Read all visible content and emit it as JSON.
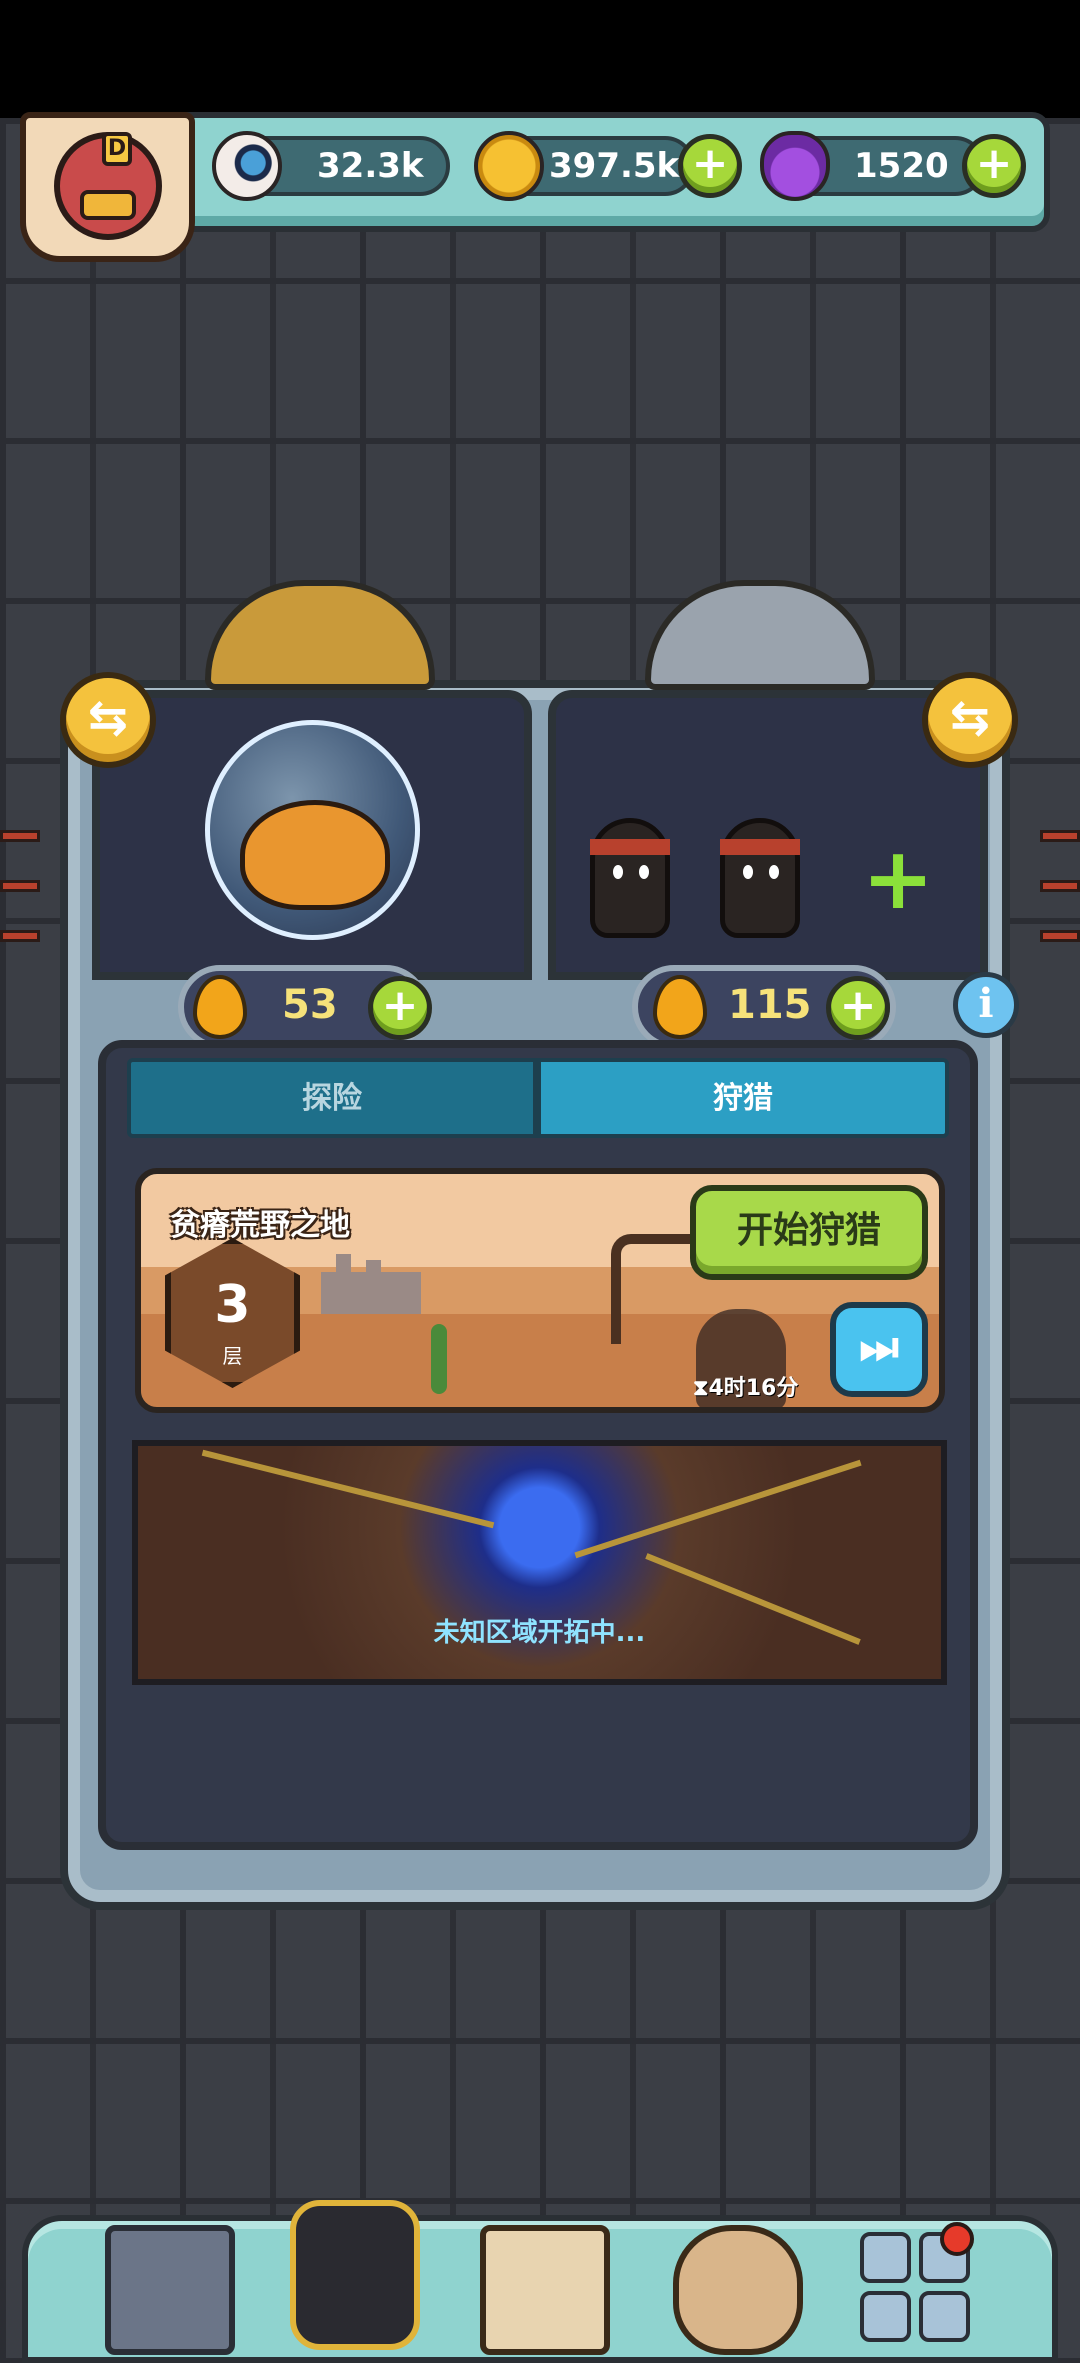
{
  "resources": {
    "eyes": "32.3k",
    "coins": "397.5k",
    "potions": "1520"
  },
  "avatar": {
    "letter": "D"
  },
  "buttons": {
    "plus": "+",
    "swap": "⇆",
    "info": "i",
    "skip": "⏭"
  },
  "energy": {
    "left": "53",
    "right": "115"
  },
  "tabs": {
    "explore": "探险",
    "hunt": "狩猎",
    "active": "hunt"
  },
  "stage": {
    "name": "贫瘠荒野之地",
    "floor": "3",
    "floor_unit": "层",
    "start_label": "开始狩猎",
    "timer": "⧗4时16分"
  },
  "vortex": {
    "text": "未知区域开拓中..."
  },
  "pods": {
    "right_add": "+"
  }
}
